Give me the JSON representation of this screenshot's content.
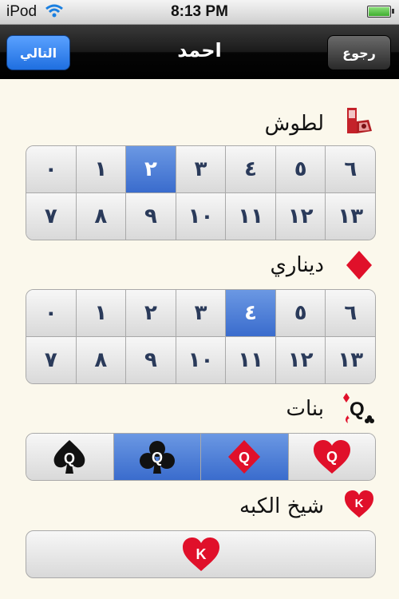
{
  "status": {
    "carrier": "iPod",
    "time": "8:13 PM"
  },
  "nav": {
    "title": "احمد",
    "next_label": "التالي",
    "back_label": "رجوع"
  },
  "sections": {
    "lutoosh": {
      "title": "لطوش",
      "icon": "lutoosh-icon",
      "rows": [
        [
          "٠",
          "١",
          "٢",
          "٣",
          "٤",
          "٥",
          "٦"
        ],
        [
          "٧",
          "٨",
          "٩",
          "١٠",
          "١١",
          "١٢",
          "١٣"
        ]
      ],
      "selected": "٢"
    },
    "diamonds": {
      "title": "ديناري",
      "icon": "diamond-icon",
      "rows": [
        [
          "٠",
          "١",
          "٢",
          "٣",
          "٤",
          "٥",
          "٦"
        ],
        [
          "٧",
          "٨",
          "٩",
          "١٠",
          "١١",
          "١٢",
          "١٣"
        ]
      ],
      "selected": "٤"
    },
    "queens": {
      "title": "بنات",
      "icon": "queens-icon",
      "options": [
        {
          "name": "queen-of-hearts",
          "rank": "Q",
          "suit": "hearts"
        },
        {
          "name": "queen-of-diamonds",
          "rank": "Q",
          "suit": "diamonds"
        },
        {
          "name": "queen-of-clubs",
          "rank": "Q",
          "suit": "clubs"
        },
        {
          "name": "queen-of-spades",
          "rank": "Q",
          "suit": "spades"
        }
      ],
      "selected": [
        "queen-of-diamonds",
        "queen-of-clubs"
      ]
    },
    "king": {
      "title": "شيخ الكبه",
      "icon": "king-of-hearts-icon",
      "rank": "K"
    }
  },
  "colors": {
    "selected": "#3a6ccd",
    "red": "#e0102a",
    "black": "#111111"
  }
}
